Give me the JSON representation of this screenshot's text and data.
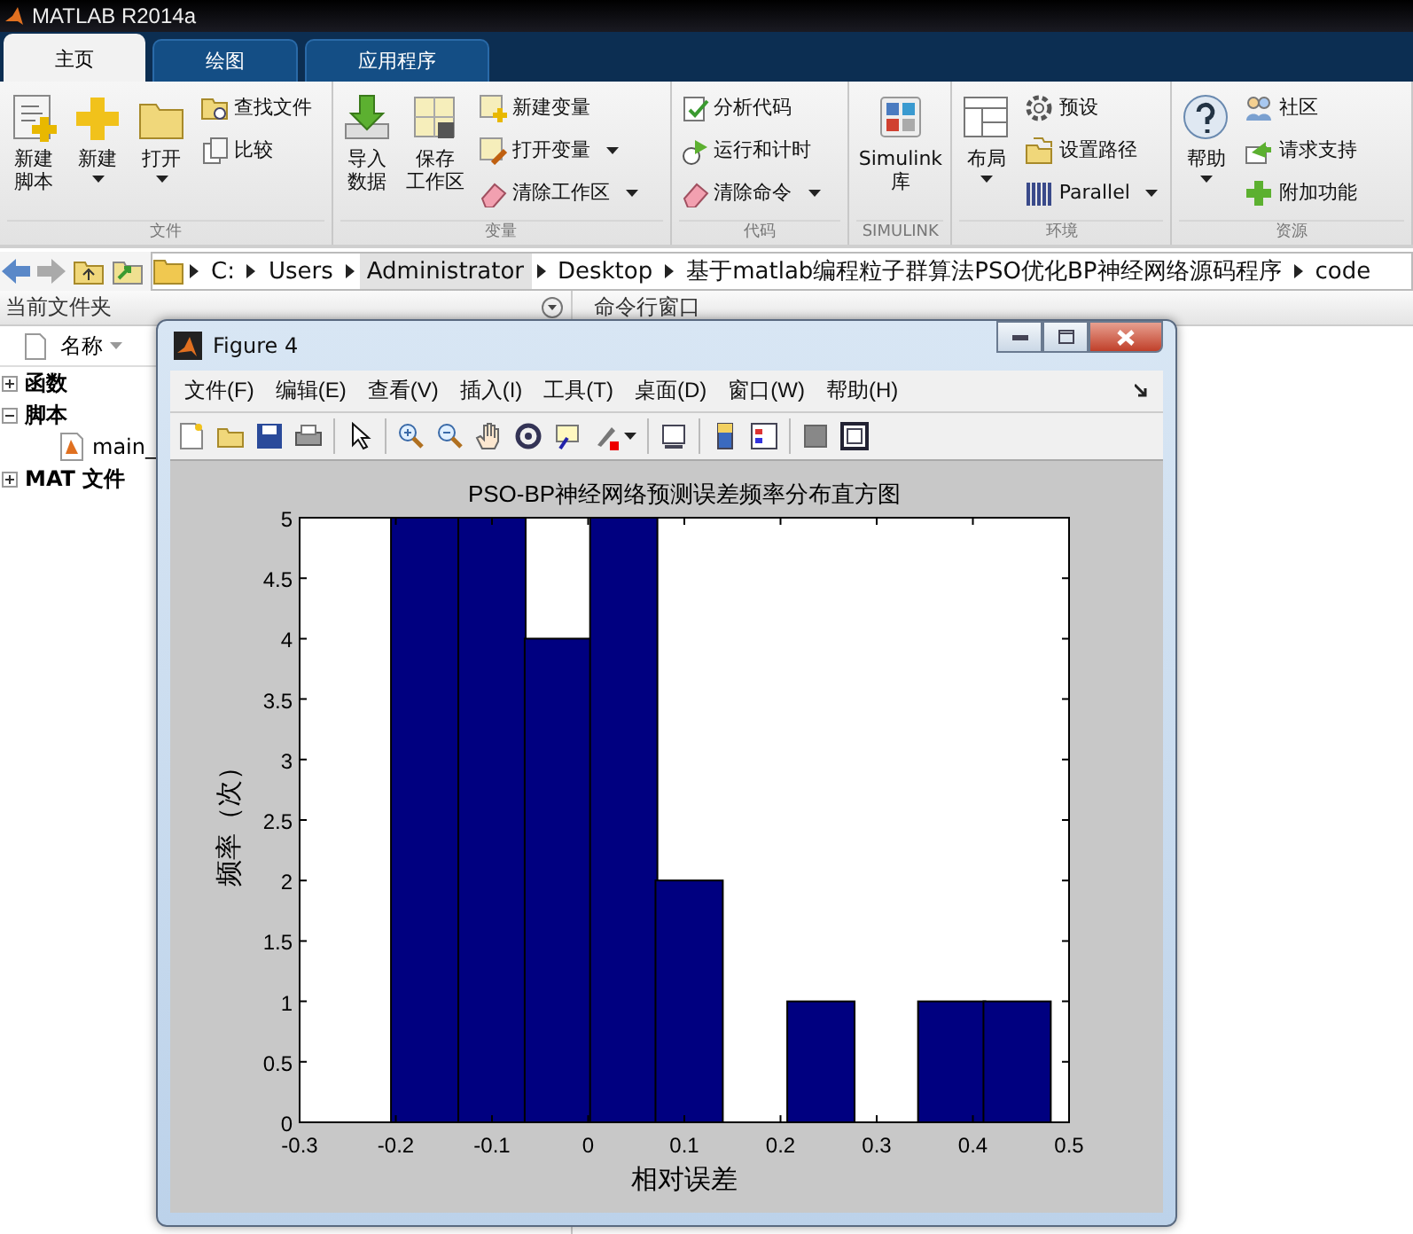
{
  "window": {
    "title": "MATLAB R2014a"
  },
  "tabs": [
    {
      "label": "主页",
      "selected": true
    },
    {
      "label": "绘图",
      "selected": false
    },
    {
      "label": "应用程序",
      "selected": false
    }
  ],
  "ribbon": {
    "groups": [
      {
        "label": "文件",
        "items": [
          {
            "kind": "large",
            "lines": [
              "新建",
              "脚本"
            ],
            "dropdown": false
          },
          {
            "kind": "large",
            "lines": [
              "新建"
            ],
            "dropdown": true
          },
          {
            "kind": "large",
            "lines": [
              "打开"
            ],
            "dropdown": true
          },
          {
            "kind": "small",
            "label": "查找文件",
            "dropdown": false
          },
          {
            "kind": "small",
            "label": "比较",
            "dropdown": false
          }
        ]
      },
      {
        "label": "变量",
        "items": [
          {
            "kind": "large",
            "lines": [
              "导入",
              "数据"
            ],
            "dropdown": false
          },
          {
            "kind": "large",
            "lines": [
              "保存",
              "工作区"
            ],
            "dropdown": false
          },
          {
            "kind": "small",
            "label": "新建变量",
            "dropdown": false
          },
          {
            "kind": "small",
            "label": "打开变量",
            "dropdown": true
          },
          {
            "kind": "small",
            "label": "清除工作区",
            "dropdown": true
          }
        ]
      },
      {
        "label": "代码",
        "items": [
          {
            "kind": "small",
            "label": "分析代码",
            "dropdown": false
          },
          {
            "kind": "small",
            "label": "运行和计时",
            "dropdown": false
          },
          {
            "kind": "small",
            "label": "清除命令",
            "dropdown": true
          }
        ]
      },
      {
        "label": "SIMULINK",
        "items": [
          {
            "kind": "large",
            "lines": [
              "Simulink",
              "库"
            ],
            "dropdown": false
          }
        ]
      },
      {
        "label": "环境",
        "items": [
          {
            "kind": "large",
            "lines": [
              "布局"
            ],
            "dropdown": true
          },
          {
            "kind": "small",
            "label": "预设",
            "dropdown": false
          },
          {
            "kind": "small",
            "label": "设置路径",
            "dropdown": false
          },
          {
            "kind": "small",
            "label": "Parallel",
            "dropdown": true
          }
        ]
      },
      {
        "label": "资源",
        "items": [
          {
            "kind": "large",
            "lines": [
              "帮助"
            ],
            "dropdown": true
          },
          {
            "kind": "small",
            "label": "社区",
            "dropdown": false
          },
          {
            "kind": "small",
            "label": "请求支持",
            "dropdown": false
          },
          {
            "kind": "small",
            "label": "附加功能",
            "dropdown": false
          }
        ]
      }
    ]
  },
  "address_bar": {
    "segments": [
      {
        "label": "C:",
        "selected": false
      },
      {
        "label": "Users",
        "selected": false
      },
      {
        "label": "Administrator",
        "selected": true
      },
      {
        "label": "Desktop",
        "selected": false
      },
      {
        "label": "基于matlab编程粒子群算法PSO优化BP神经网络源码程序",
        "selected": false
      },
      {
        "label": "code",
        "selected": false
      }
    ]
  },
  "current_folder": {
    "title": "当前文件夹",
    "column": "名称",
    "tree": [
      {
        "label": "函数",
        "expanded": false
      },
      {
        "label": "脚本",
        "expanded": true,
        "children": [
          {
            "label": "main_"
          }
        ]
      },
      {
        "label": "MAT 文件",
        "expanded": false
      }
    ]
  },
  "command_window": {
    "title": "命令行窗口"
  },
  "figure": {
    "title": "Figure 4",
    "menus": [
      "文件(F)",
      "编辑(E)",
      "查看(V)",
      "插入(I)",
      "工具(T)",
      "桌面(D)",
      "窗口(W)",
      "帮助(H)"
    ],
    "chart_data": {
      "type": "bar",
      "title": "PSO-BP神经网络预测误差频率分布直方图",
      "xlabel": "相对误差",
      "ylabel": "频率（次）",
      "x": [
        -0.17,
        -0.1,
        -0.031,
        0.037,
        0.105,
        0.173,
        0.242,
        0.31,
        0.378,
        0.446
      ],
      "series": [
        {
          "color": "#000080",
          "values": [
            5,
            5,
            4,
            5,
            2,
            0,
            1,
            0,
            1,
            1
          ]
        }
      ],
      "xlim": [
        -0.3,
        0.5
      ],
      "ylim": [
        0,
        5
      ],
      "xticks": [
        -0.3,
        -0.2,
        -0.1,
        0,
        0.1,
        0.2,
        0.3,
        0.4,
        0.5
      ],
      "yticks": [
        0,
        0.5,
        1,
        1.5,
        2,
        2.5,
        3,
        3.5,
        4,
        4.5,
        5
      ]
    }
  }
}
